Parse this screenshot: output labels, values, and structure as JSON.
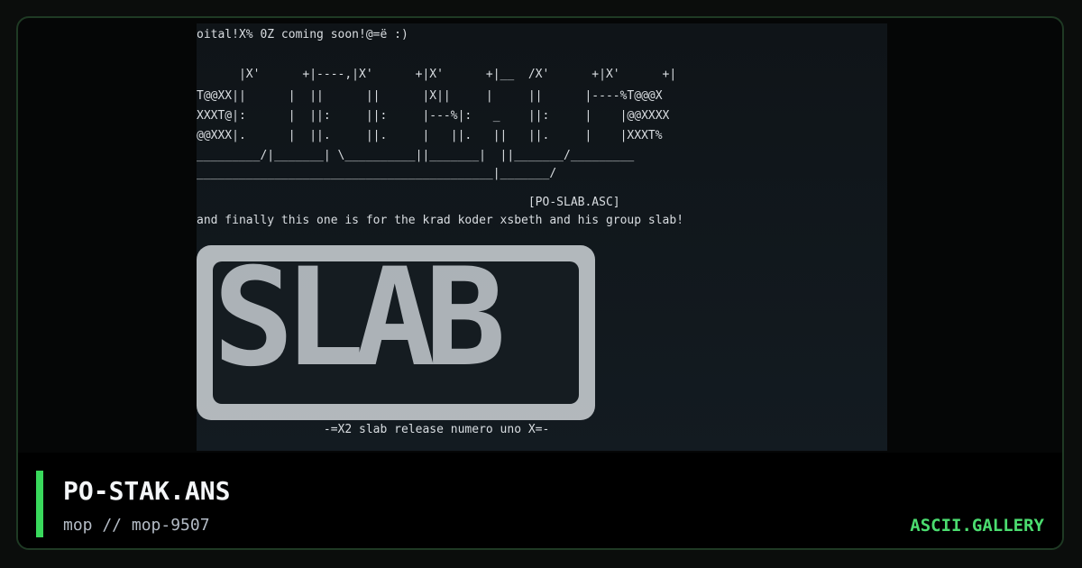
{
  "preview": {
    "ascii_lines": [
      "oital!X% 0Z coming soon!@=ë :)",
      "",
      "      |X'      +|----,|X'      +|X'      +|__  /X'      +|X'      +|",
      "T@@XX||      |  ||      ||      |X||     |     ||      |----%T@@@X",
      "XXXT@|:      |  ||:     ||:     |---%|:   _    ||:     |    |@@XXXX",
      "@@XXX|.      |  ||.     ||.     |   ||.   ||   ||.     |    |XXXT%",
      "_________/|_______| \\__________||_______|  ||_______/_________",
      "__________________________________________|_______/",
      "",
      "                                               [PO-SLAB.ASC]",
      "and finally this one is for the krad koder xsbeth and his group slab!",
      "",
      "                  -=X2 slab release numero uno X=-"
    ],
    "slab_text": "SLAB"
  },
  "footer": {
    "title": "PO-STAK.ANS",
    "subtitle": "mop // mop-9507",
    "brand": "ASCII.GALLERY"
  },
  "colors": {
    "accent": "#39d95c",
    "brand": "#4bdc6f",
    "frame_border": "#1f3a24"
  }
}
